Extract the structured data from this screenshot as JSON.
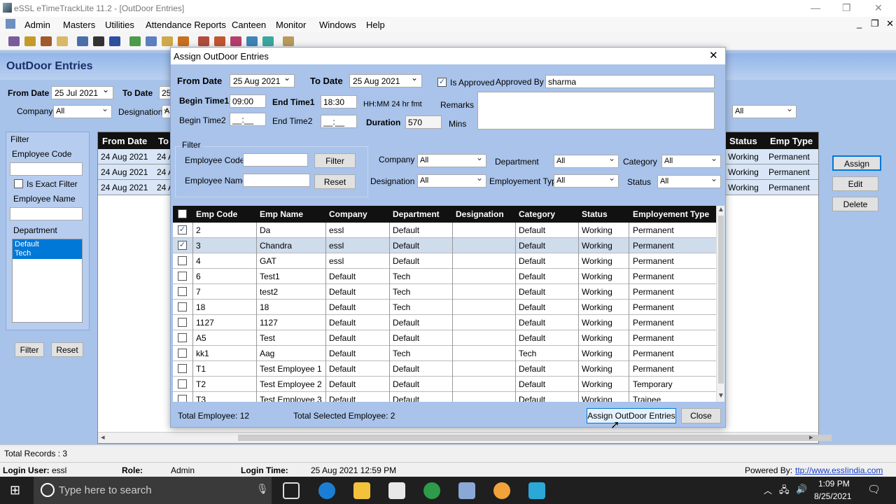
{
  "app": {
    "title": "eSSL eTimeTrackLite 11.2 - [OutDoor Entries]"
  },
  "menu": [
    "Admin",
    "Masters",
    "Utilities",
    "Attendance Reports",
    "Canteen",
    "Monitor",
    "Windows",
    "Help"
  ],
  "page": {
    "title": "OutDoor Entries",
    "from_date_label": "From Date",
    "from_date": "25 Jul 2021",
    "to_date_label": "To Date",
    "to_date": "25",
    "company_label": "Company",
    "company": "All",
    "designation_label": "Designation",
    "designation": "Al",
    "extra_select": "All"
  },
  "left_filter": {
    "group": "Filter",
    "emp_code_label": "Employee Code",
    "exact_label": "Is Exact Filter",
    "emp_name_label": "Employee Name",
    "department_label": "Department",
    "departments": [
      "Default",
      "Tech"
    ],
    "filter_btn": "Filter",
    "reset_btn": "Reset"
  },
  "bg_grid": {
    "headers": [
      "From Date",
      "To",
      "Status",
      "Emp Type"
    ],
    "rows": [
      {
        "from": "24 Aug 2021",
        "to": "24 A",
        "status": "Working",
        "type": "Permanent"
      },
      {
        "from": "24 Aug 2021",
        "to": "24 A",
        "status": "Working",
        "type": "Permanent"
      },
      {
        "from": "24 Aug 2021",
        "to": "24 A",
        "status": "Working",
        "type": "Permanent"
      }
    ]
  },
  "side_buttons": {
    "assign": "Assign",
    "edit": "Edit",
    "delete": "Delete"
  },
  "modal": {
    "title": "Assign OutDoor Entries",
    "from_date_label": "From Date",
    "from_date": "25 Aug 2021",
    "to_date_label": "To Date",
    "to_date": "25 Aug 2021",
    "approved_label": "Is Approved",
    "approved_by_label": "Approved By",
    "approved_by": "sharma",
    "begin1_label": "Begin Time1",
    "begin1": "09:00",
    "end1_label": "End Time1",
    "end1": "18:30",
    "begin2_label": "Begin Time2",
    "begin2": "__:__",
    "end2_label": "End Time2",
    "end2": "__:__",
    "fmt_hint": "HH:MM 24 hr fmt",
    "remarks_label": "Remarks",
    "duration_label": "Duration",
    "duration": "570",
    "mins": "Mins",
    "filter_group": "Filter",
    "emp_code_label": "Employee Code",
    "emp_name_label": "Employee Name",
    "filter_btn": "Filter",
    "reset_btn": "Reset",
    "company_label": "Company",
    "company": "All",
    "department_label": "Department",
    "department": "All",
    "category_label": "Category",
    "category": "All",
    "designation_label": "Designation",
    "designation": "All",
    "emptype_label": "Employement Type",
    "emptype": "All",
    "status_label": "Status",
    "status": "All",
    "columns": [
      "Emp Code",
      "Emp Name",
      "Company",
      "Department",
      "Designation",
      "Category",
      "Status",
      "Employement Type"
    ],
    "rows": [
      {
        "checked": true,
        "code": "2",
        "name": "Da",
        "company": "essl",
        "dept": "Default",
        "desig": "",
        "cat": "Default",
        "status": "Working",
        "type": "Permanent"
      },
      {
        "checked": true,
        "code": "3",
        "name": "Chandra",
        "company": "essl",
        "dept": "Default",
        "desig": "",
        "cat": "Default",
        "status": "Working",
        "type": "Permanent"
      },
      {
        "checked": false,
        "code": "4",
        "name": "GAT",
        "company": "essl",
        "dept": "Default",
        "desig": "",
        "cat": "Default",
        "status": "Working",
        "type": "Permanent"
      },
      {
        "checked": false,
        "code": "6",
        "name": "Test1",
        "company": "Default",
        "dept": "Tech",
        "desig": "",
        "cat": "Default",
        "status": "Working",
        "type": "Permanent"
      },
      {
        "checked": false,
        "code": "7",
        "name": "test2",
        "company": "Default",
        "dept": "Tech",
        "desig": "",
        "cat": "Default",
        "status": "Working",
        "type": "Permanent"
      },
      {
        "checked": false,
        "code": "18",
        "name": "18",
        "company": "Default",
        "dept": "Tech",
        "desig": "",
        "cat": "Default",
        "status": "Working",
        "type": "Permanent"
      },
      {
        "checked": false,
        "code": "1127",
        "name": "1127",
        "company": "Default",
        "dept": "Default",
        "desig": "",
        "cat": "Default",
        "status": "Working",
        "type": "Permanent"
      },
      {
        "checked": false,
        "code": "A5",
        "name": "Test",
        "company": "Default",
        "dept": "Default",
        "desig": "",
        "cat": "Default",
        "status": "Working",
        "type": "Permanent"
      },
      {
        "checked": false,
        "code": "kk1",
        "name": "Aag",
        "company": "Default",
        "dept": "Tech",
        "desig": "",
        "cat": "Tech",
        "status": "Working",
        "type": "Permanent"
      },
      {
        "checked": false,
        "code": "T1",
        "name": "Test Employee 1",
        "company": "Default",
        "dept": "Default",
        "desig": "",
        "cat": "Default",
        "status": "Working",
        "type": "Permanent"
      },
      {
        "checked": false,
        "code": "T2",
        "name": "Test Employee 2",
        "company": "Default",
        "dept": "Default",
        "desig": "",
        "cat": "Default",
        "status": "Working",
        "type": "Temporary"
      },
      {
        "checked": false,
        "code": "T3",
        "name": "Test Employee 3",
        "company": "Default",
        "dept": "Default",
        "desig": "",
        "cat": "Default",
        "status": "Working",
        "type": "Trainee"
      }
    ],
    "total_label": "Total Employee: 12",
    "selected_label": "Total Selected Employee: 2",
    "assign_btn": "Assign OutDoor Entries",
    "close_btn": "Close"
  },
  "status": {
    "total_records": "Total Records : 3",
    "login_user_label": "Login User:",
    "login_user": "essl",
    "role_label": "Role:",
    "role": "Admin",
    "login_time_label": "Login Time:",
    "login_time": "25 Aug 2021 12:59 PM",
    "powered_label": "Powered By:",
    "powered_url": "ttp://www.essIindia.com"
  },
  "taskbar": {
    "search_placeholder": "Type here to search",
    "time": "1:09 PM",
    "date": "8/25/2021"
  }
}
